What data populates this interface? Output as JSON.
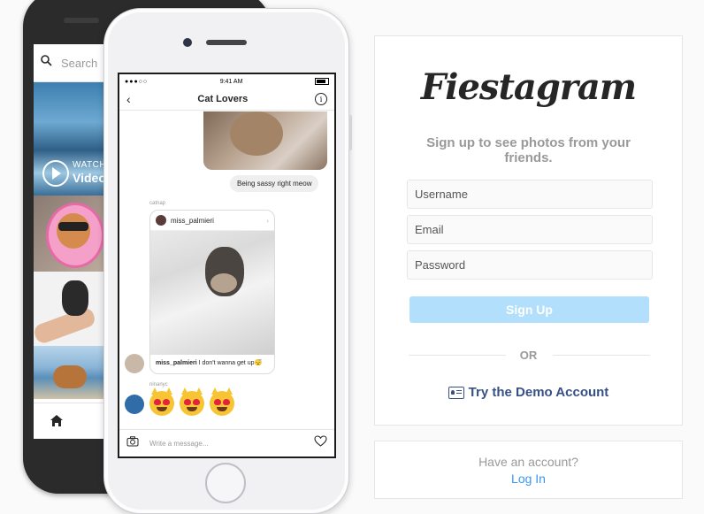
{
  "back_phone": {
    "search_placeholder": "Search",
    "video_watch": "WATCH",
    "video_label": "Video"
  },
  "front_phone": {
    "status": {
      "signal": "●●●○○",
      "time": "9:41 AM"
    },
    "chat_title": "Cat Lovers",
    "message_bubble": "Being sassy right meow",
    "sender_1": "catnap",
    "shared_post_user": "miss_palmieri",
    "shared_post_caption_user": "miss_palmieri",
    "shared_post_caption": "I don't wanna get up😴",
    "sender_2": "ninanyc",
    "input_placeholder": "Write a message..."
  },
  "signup": {
    "logo": "Fiestagram",
    "tagline": "Sign up to see photos from your friends.",
    "username_placeholder": "Username",
    "email_placeholder": "Email",
    "password_placeholder": "Password",
    "signup_label": "Sign Up",
    "or_label": "OR",
    "demo_label": "Try the Demo Account",
    "have_account": "Have an account?",
    "login_label": "Log In"
  },
  "colors": {
    "primary_button": "#b2dffc",
    "link": "#3897f0",
    "demo_link": "#385185"
  }
}
